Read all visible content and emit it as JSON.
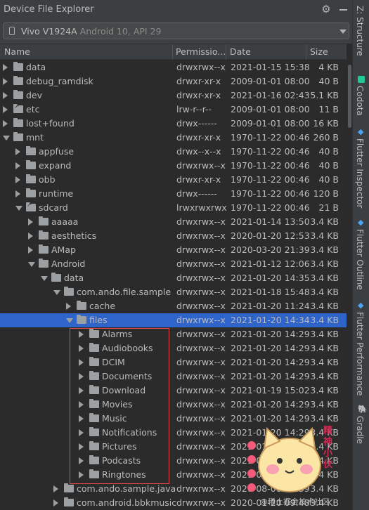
{
  "window": {
    "title": "Device File Explorer"
  },
  "device": {
    "name": "Vivo V1924A",
    "details": "Android 10, API 29"
  },
  "columns": {
    "name": "Name",
    "permissions": "Permissio...",
    "date": "Date",
    "size": "Size"
  },
  "rows": [
    {
      "name": "data",
      "perm": "drwxrwx--x",
      "date": "2021-01-15 15:38",
      "size": "4 KB",
      "depth": 0,
      "state": "collapsed"
    },
    {
      "name": "debug_ramdisk",
      "perm": "drwxr-xr-x",
      "date": "2009-01-01 08:00",
      "size": "40 B",
      "depth": 0,
      "state": "collapsed"
    },
    {
      "name": "dev",
      "perm": "drwxr-xr-x",
      "date": "2021-01-16 02:43",
      "size": "5.1 KB",
      "depth": 0,
      "state": "collapsed"
    },
    {
      "name": "etc",
      "perm": "lrw-r--r--",
      "date": "2009-01-01 08:00",
      "size": "11 B",
      "depth": 0,
      "state": "collapsed",
      "link": true
    },
    {
      "name": "lost+found",
      "perm": "drwx------",
      "date": "2009-01-01 08:00",
      "size": "16 KB",
      "depth": 0,
      "state": "collapsed"
    },
    {
      "name": "mnt",
      "perm": "drwxr-xr-x",
      "date": "1970-11-22 00:46",
      "size": "260 B",
      "depth": 0,
      "state": "expanded"
    },
    {
      "name": "appfuse",
      "perm": "drwx--x--x",
      "date": "1970-11-22 00:46",
      "size": "40 B",
      "depth": 1,
      "state": "collapsed"
    },
    {
      "name": "expand",
      "perm": "drwxrwx--x",
      "date": "1970-11-22 00:46",
      "size": "40 B",
      "depth": 1,
      "state": "collapsed"
    },
    {
      "name": "obb",
      "perm": "drwxr-xr-x",
      "date": "1970-11-22 00:46",
      "size": "40 B",
      "depth": 1,
      "state": "collapsed"
    },
    {
      "name": "runtime",
      "perm": "drwx------",
      "date": "1970-11-22 00:46",
      "size": "120 B",
      "depth": 1,
      "state": "collapsed"
    },
    {
      "name": "sdcard",
      "perm": "lrwxrwxrwx",
      "date": "1970-11-22 00:46",
      "size": "21 B",
      "depth": 1,
      "state": "expanded",
      "link": true
    },
    {
      "name": "aaaaa",
      "perm": "drwxrwx--x",
      "date": "2021-01-14 13:50",
      "size": "3.4 KB",
      "depth": 2,
      "state": "collapsed"
    },
    {
      "name": "aesthetics",
      "perm": "drwxrwx--x",
      "date": "2020-01-20 12:53",
      "size": "3.4 KB",
      "depth": 2,
      "state": "collapsed"
    },
    {
      "name": "AMap",
      "perm": "drwxrwx--x",
      "date": "2020-03-20 21:39",
      "size": "3.4 KB",
      "depth": 2,
      "state": "collapsed"
    },
    {
      "name": "Android",
      "perm": "drwxrwx--x",
      "date": "2021-01-12 12:06",
      "size": "3.4 KB",
      "depth": 2,
      "state": "expanded"
    },
    {
      "name": "data",
      "perm": "drwxrwx--x",
      "date": "2021-01-20 14:35",
      "size": "3.4 KB",
      "depth": 3,
      "state": "expanded"
    },
    {
      "name": "com.ando.file.sample",
      "perm": "drwxrwx--x",
      "date": "2021-01-18 15:48",
      "size": "3.4 KB",
      "depth": 4,
      "state": "expanded"
    },
    {
      "name": "cache",
      "perm": "drwxrwx--x",
      "date": "2021-01-20 11:24",
      "size": "3.4 KB",
      "depth": 5,
      "state": "collapsed"
    },
    {
      "name": "files",
      "perm": "drwxrwx--x",
      "date": "2021-01-20 14:34",
      "size": "3.4 KB",
      "depth": 5,
      "state": "expanded",
      "selected": true
    },
    {
      "name": "Alarms",
      "perm": "drwxrwx--x",
      "date": "2021-01-20 14:29",
      "size": "3.4 KB",
      "depth": 6,
      "state": "collapsed"
    },
    {
      "name": "Audiobooks",
      "perm": "drwxrwx--x",
      "date": "2021-01-20 14:29",
      "size": "3.4 KB",
      "depth": 6,
      "state": "collapsed"
    },
    {
      "name": "DCIM",
      "perm": "drwxrwx--x",
      "date": "2021-01-20 14:29",
      "size": "3.4 KB",
      "depth": 6,
      "state": "collapsed"
    },
    {
      "name": "Documents",
      "perm": "drwxrwx--x",
      "date": "2021-01-20 14:29",
      "size": "3.4 KB",
      "depth": 6,
      "state": "collapsed"
    },
    {
      "name": "Download",
      "perm": "drwxrwx--x",
      "date": "2021-01-19 15:02",
      "size": "3.4 KB",
      "depth": 6,
      "state": "collapsed"
    },
    {
      "name": "Movies",
      "perm": "drwxrwx--x",
      "date": "2021-01-20 14:29",
      "size": "3.4 KB",
      "depth": 6,
      "state": "collapsed"
    },
    {
      "name": "Music",
      "perm": "drwxrwx--x",
      "date": "2021-01-20 14:29",
      "size": "3.4 KB",
      "depth": 6,
      "state": "collapsed"
    },
    {
      "name": "Notifications",
      "perm": "drwxrwx--x",
      "date": "2021-01-20 14:29",
      "size": "3.4 KB",
      "depth": 6,
      "state": "collapsed"
    },
    {
      "name": "Pictures",
      "perm": "drwxrwx--x",
      "date": "2021-01-20 14:29",
      "size": "3.4 KB",
      "depth": 6,
      "state": "collapsed"
    },
    {
      "name": "Podcasts",
      "perm": "drwxrwx--x",
      "date": "2021-01-20 14:29",
      "size": "3.4 KB",
      "depth": 6,
      "state": "collapsed"
    },
    {
      "name": "Ringtones",
      "perm": "drwxrwx--x",
      "date": "2021-01-20 14:29",
      "size": "3.4 KB",
      "depth": 6,
      "state": "collapsed"
    },
    {
      "name": "com.ando.sample.java",
      "perm": "drwxrwx--x",
      "date": "2020-08-06 17:39",
      "size": "3.4 KB",
      "depth": 4,
      "state": "collapsed"
    },
    {
      "name": "com.android.bbkmusic",
      "perm": "drwxrwx--x",
      "date": "2020-01-20 09:48",
      "size": "3.4 KB",
      "depth": 4,
      "state": "collapsed"
    }
  ],
  "sidebar": {
    "tabs": [
      {
        "label": "Z: Structure",
        "icon": "none"
      },
      {
        "label": "Codota",
        "icon": "codota-icon"
      },
      {
        "label": "Flutter Inspector",
        "icon": "flutter-icon"
      },
      {
        "label": "Flutter Outline",
        "icon": "flutter-icon"
      },
      {
        "label": "Flutter Performance",
        "icon": "flutter-icon"
      },
      {
        "label": "Gradle",
        "icon": "gradle-icon"
      }
    ]
  },
  "overlay": {
    "mascot_text": "精神小伙",
    "watermark": "@稀土掘金技术社区"
  }
}
